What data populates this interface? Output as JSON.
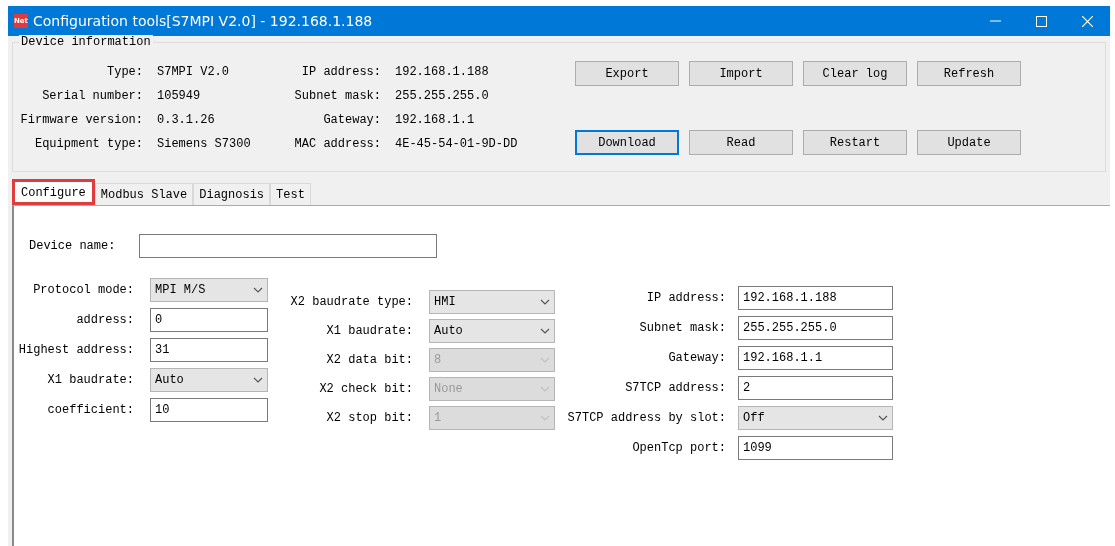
{
  "window": {
    "title": "Configuration tools[S7MPI V2.0] - 192.168.1.188",
    "icon_text": "Net"
  },
  "device_info": {
    "title": "Device information",
    "left_fields": [
      {
        "label": "Type:",
        "value": "S7MPI V2.0"
      },
      {
        "label": "Serial number:",
        "value": "105949"
      },
      {
        "label": "Firmware version:",
        "value": "0.3.1.26"
      },
      {
        "label": "Equipment type:",
        "value": "Siemens S7300"
      }
    ],
    "right_fields": [
      {
        "label": "IP  address:",
        "value": "192.168.1.188"
      },
      {
        "label": "Subnet mask:",
        "value": "255.255.255.0"
      },
      {
        "label": "Gateway:",
        "value": "192.168.1.1"
      },
      {
        "label": "MAC address:",
        "value": "4E-45-54-01-9D-DD"
      }
    ],
    "button_rows": [
      [
        {
          "label": "Export",
          "focused": false
        },
        {
          "label": "Import",
          "focused": false
        },
        {
          "label": "Clear log",
          "focused": false
        },
        {
          "label": "Refresh",
          "focused": false
        }
      ],
      [
        {
          "label": "Download",
          "focused": true
        },
        {
          "label": "Read",
          "focused": false
        },
        {
          "label": "Restart",
          "focused": false
        },
        {
          "label": "Update",
          "focused": false
        }
      ]
    ]
  },
  "tabs": [
    {
      "label": "Configure",
      "selected": true
    },
    {
      "label": "Modbus Slave",
      "selected": false
    },
    {
      "label": "Diagnosis",
      "selected": false
    },
    {
      "label": "Test",
      "selected": false
    }
  ],
  "form": {
    "device_name": {
      "label": "Device name:"
    },
    "columns": [
      [
        {
          "kind": "select",
          "label": "Protocol mode:",
          "value": "MPI M/S",
          "disabled": false
        },
        {
          "kind": "text",
          "label": "address:",
          "value": "0"
        },
        {
          "kind": "text",
          "label": "Highest address:",
          "value": "31"
        },
        {
          "kind": "select",
          "label": "X1 baudrate:",
          "value": "Auto",
          "disabled": false
        },
        {
          "kind": "text",
          "label": "coefficient:",
          "value": "10"
        }
      ],
      [
        {
          "kind": "select",
          "label": "X2 baudrate type:",
          "value": "HMI",
          "disabled": false
        },
        {
          "kind": "select",
          "label": "X1 baudrate:",
          "value": "Auto",
          "disabled": false
        },
        {
          "kind": "select",
          "label": "X2 data bit:",
          "value": "8",
          "disabled": true
        },
        {
          "kind": "select",
          "label": "X2 check bit:",
          "value": "None",
          "disabled": true
        },
        {
          "kind": "select",
          "label": "X2 stop bit:",
          "value": "1",
          "disabled": true
        }
      ],
      [
        {
          "kind": "text",
          "label": "IP  address:",
          "value": "192.168.1.188"
        },
        {
          "kind": "text",
          "label": "Subnet mask:",
          "value": "255.255.255.0"
        },
        {
          "kind": "text",
          "label": "Gateway:",
          "value": "192.168.1.1"
        },
        {
          "kind": "text",
          "label": "S7TCP address:",
          "value": "2"
        },
        {
          "kind": "select",
          "label": "S7TCP address by slot:",
          "value": "Off",
          "disabled": false
        },
        {
          "kind": "text",
          "label": "OpenTcp port:",
          "value": "1099"
        }
      ]
    ]
  }
}
